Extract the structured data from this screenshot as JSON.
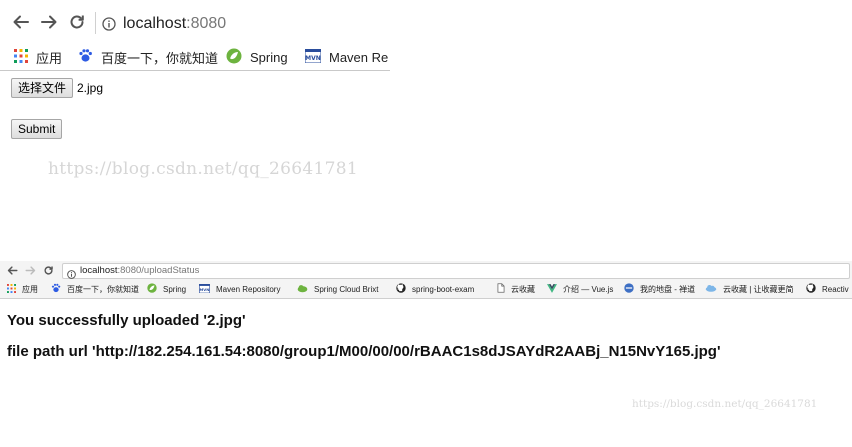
{
  "top_browser": {
    "url_host": "localhost",
    "url_port": ":8080",
    "bookmarks": [
      {
        "label": "应用",
        "icon": "apps-grid-icon"
      },
      {
        "label": "百度一下，你就知道",
        "icon": "baidu-paw-icon"
      },
      {
        "label": "Spring",
        "icon": "spring-leaf-icon"
      },
      {
        "label": "Maven Re",
        "icon": "maven-icon"
      }
    ]
  },
  "form": {
    "file_button_label": "选择文件",
    "file_name": "2.jpg",
    "submit_label": "Submit"
  },
  "watermark_1": "https://blog.csdn.net/qq_26641781",
  "bottom_browser": {
    "url_host": "localhost",
    "url_rest": ":8080/uploadStatus",
    "bookmarks": [
      {
        "label": "应用",
        "icon": "apps-grid-icon"
      },
      {
        "label": "百度一下，你就知道",
        "icon": "baidu-paw-icon"
      },
      {
        "label": "Spring",
        "icon": "spring-leaf-icon"
      },
      {
        "label": "Maven Repository",
        "icon": "maven-icon"
      },
      {
        "label": "Spring Cloud Brixt",
        "icon": "spring-cloud-icon"
      },
      {
        "label": "spring-boot-exam",
        "icon": "github-icon"
      },
      {
        "label": "云收藏",
        "icon": "page-icon"
      },
      {
        "label": "介绍 — Vue.js",
        "icon": "vue-icon"
      },
      {
        "label": "我的地盘 - 禅道",
        "icon": "zentao-icon"
      },
      {
        "label": "云收藏 | 让收藏更简",
        "icon": "cloud-icon"
      },
      {
        "label": "Reactiv",
        "icon": "github-icon"
      }
    ]
  },
  "result": {
    "success_message": "You successfully uploaded '2.jpg'",
    "path_message": "file path url 'http://182.254.161.54:8080/group1/M00/00/00/rBAAC1s8dJSAYdR2AABj_N15NvY165.jpg'"
  },
  "watermark_2": "https://blog.csdn.net/qq_26641781",
  "colors": {
    "accent_apps": "#e0443a",
    "baidu": "#2d5be3",
    "spring": "#6db33f",
    "maven": "#2a4d9c",
    "vue": "#41b883"
  }
}
